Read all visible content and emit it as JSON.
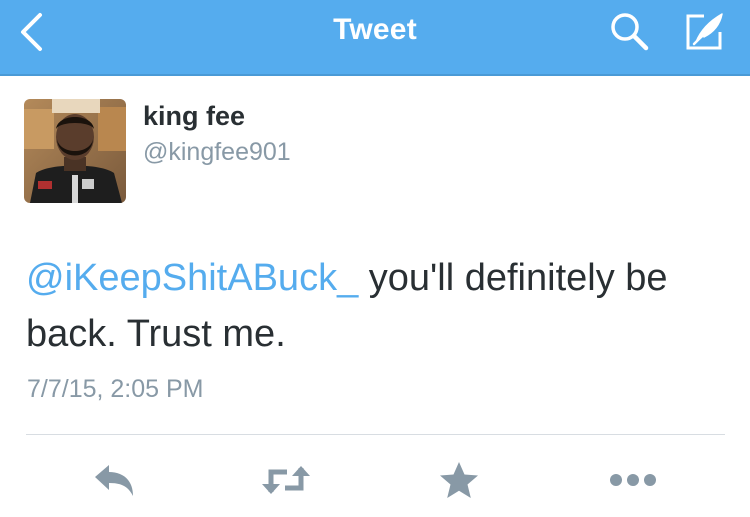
{
  "navbar": {
    "title": "Tweet",
    "icons": {
      "back": "chevron-left-icon",
      "search": "search-icon",
      "compose": "compose-icon"
    },
    "background_color": "#55acee"
  },
  "tweet": {
    "author": {
      "display_name": "king fee",
      "username": "@kingfee901"
    },
    "mention": "@iKeepShitABuck_",
    "text": " you'll definitely be back. Trust me.",
    "timestamp": "7/7/15, 2:05 PM",
    "link_color": "#55acee"
  },
  "actions": [
    {
      "name": "reply",
      "icon": "reply-icon"
    },
    {
      "name": "retweet",
      "icon": "retweet-icon"
    },
    {
      "name": "favorite",
      "icon": "star-icon"
    },
    {
      "name": "more",
      "icon": "more-icon"
    }
  ]
}
